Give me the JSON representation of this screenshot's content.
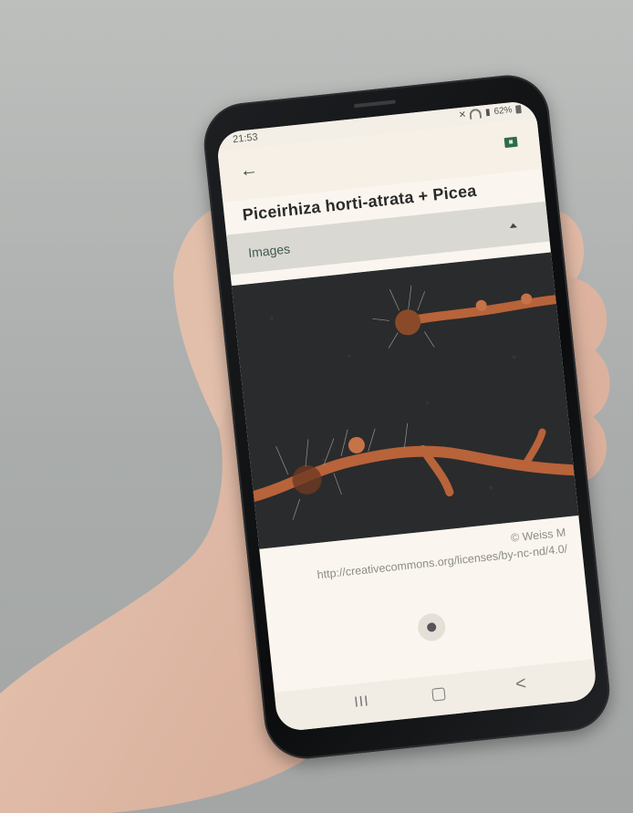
{
  "status_bar": {
    "time": "21:53",
    "battery": "62%"
  },
  "app_bar": {
    "back_icon": "arrow-left-icon",
    "save_icon": "save-to-folder-icon"
  },
  "title": "Piceirhiza horti-atrata + Picea",
  "section": {
    "label": "Images",
    "expanded": true
  },
  "image": {
    "description_icon": "root-photo",
    "author": "© Weiss M",
    "license": "http://creativecommons.org/licenses/by-nc-nd/4.0/"
  },
  "pager": {
    "current": 1,
    "total": 1
  },
  "nav_bar": {
    "recents": "III",
    "back": "<"
  },
  "colors": {
    "accent": "#2f6a4c",
    "screen_bg": "#faf6ef",
    "section_bg": "#dad8d2"
  }
}
